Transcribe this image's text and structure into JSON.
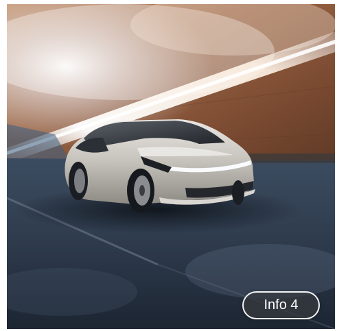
{
  "image": {
    "subject": "car-in-tunnel-photo"
  },
  "button": {
    "label": "Info 4"
  },
  "colors": {
    "tunnel_wall": "#8f5c3d",
    "road": "#2f3c4d",
    "car_body": "#c9c6c1",
    "light_streak": "#fff4e6"
  }
}
